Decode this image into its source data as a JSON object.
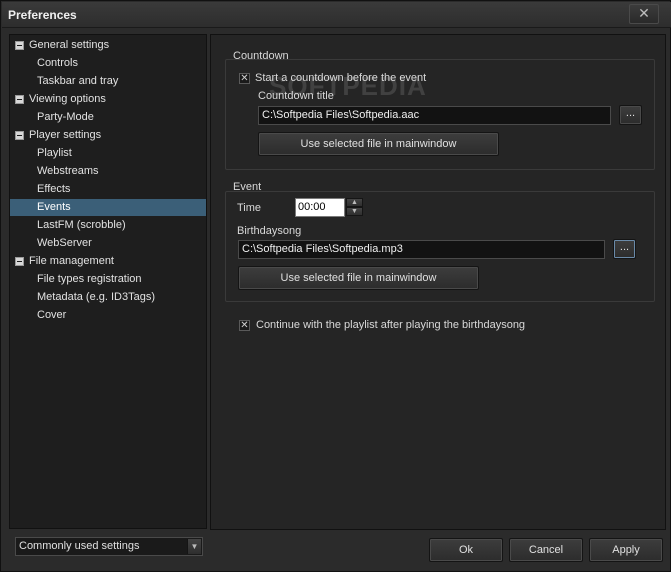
{
  "window": {
    "title": "Preferences",
    "close_glyph": "✕"
  },
  "watermark": "SOFTPEDIA",
  "tree": [
    {
      "label": "General settings",
      "level": 0,
      "selected": false
    },
    {
      "label": "Controls",
      "level": 1,
      "selected": false
    },
    {
      "label": "Taskbar and tray",
      "level": 1,
      "selected": false
    },
    {
      "label": "Viewing options",
      "level": 0,
      "selected": false
    },
    {
      "label": "Party-Mode",
      "level": 1,
      "selected": false
    },
    {
      "label": "Player settings",
      "level": 0,
      "selected": false
    },
    {
      "label": "Playlist",
      "level": 1,
      "selected": false
    },
    {
      "label": "Webstreams",
      "level": 1,
      "selected": false
    },
    {
      "label": "Effects",
      "level": 1,
      "selected": false
    },
    {
      "label": "Events",
      "level": 1,
      "selected": true
    },
    {
      "label": "LastFM (scrobble)",
      "level": 1,
      "selected": false
    },
    {
      "label": "WebServer",
      "level": 1,
      "selected": false
    },
    {
      "label": "File management",
      "level": 0,
      "selected": false
    },
    {
      "label": "File types registration",
      "level": 1,
      "selected": false
    },
    {
      "label": "Metadata (e.g. ID3Tags)",
      "level": 1,
      "selected": false
    },
    {
      "label": "Cover",
      "level": 1,
      "selected": false
    }
  ],
  "countdown": {
    "group_title": "Countdown",
    "checkbox_label": "Start a countdown before the event",
    "checked": true,
    "title_label": "Countdown title",
    "file_value": "C:\\Softpedia Files\\Softpedia.aac",
    "browse_label": "...",
    "use_selected_label": "Use selected file in mainwindow"
  },
  "event": {
    "group_title": "Event",
    "time_label": "Time",
    "time_value": "00:00",
    "birthdaysong_label": "Birthdaysong",
    "file_value": "C:\\Softpedia Files\\Softpedia.mp3",
    "browse_label": "...",
    "use_selected_label": "Use selected file in mainwindow"
  },
  "continue_playlist": {
    "label": "Continue with the playlist after playing the birthdaysong",
    "checked": true
  },
  "footer": {
    "combo_value": "Commonly used settings",
    "ok_label": "Ok",
    "cancel_label": "Cancel",
    "apply_label": "Apply"
  },
  "check_glyph": "✕"
}
